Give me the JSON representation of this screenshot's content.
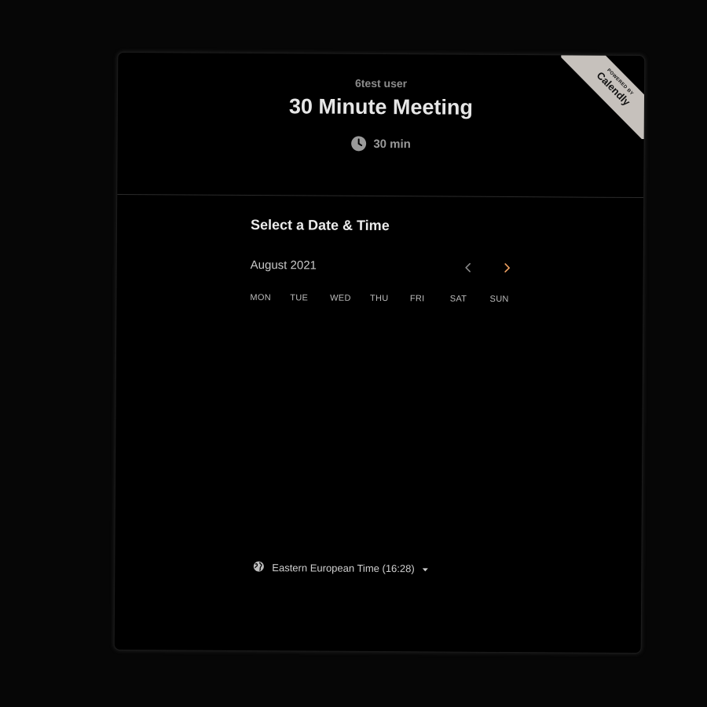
{
  "event": {
    "host_name": "6test user",
    "title": "30 Minute Meeting",
    "duration": "30 min",
    "duration_icon": "clock-icon"
  },
  "badge": {
    "small_text": "POWERED BY",
    "brand": "Calendly"
  },
  "scheduler": {
    "section_title": "Select a Date & Time",
    "month_label": "August 2021",
    "prev_icon": "chevron-left-icon",
    "next_icon": "chevron-right-icon",
    "weekdays": [
      "MON",
      "TUE",
      "WED",
      "THU",
      "FRI",
      "SAT",
      "SUN"
    ]
  },
  "timezone": {
    "label": "Eastern European Time (16:28)",
    "icon": "globe-icon",
    "caret_icon": "caret-down-icon"
  },
  "colors": {
    "background": "#060606",
    "card": "#000000",
    "accent": "#f2a363",
    "ribbon": "#c6c1bc"
  }
}
